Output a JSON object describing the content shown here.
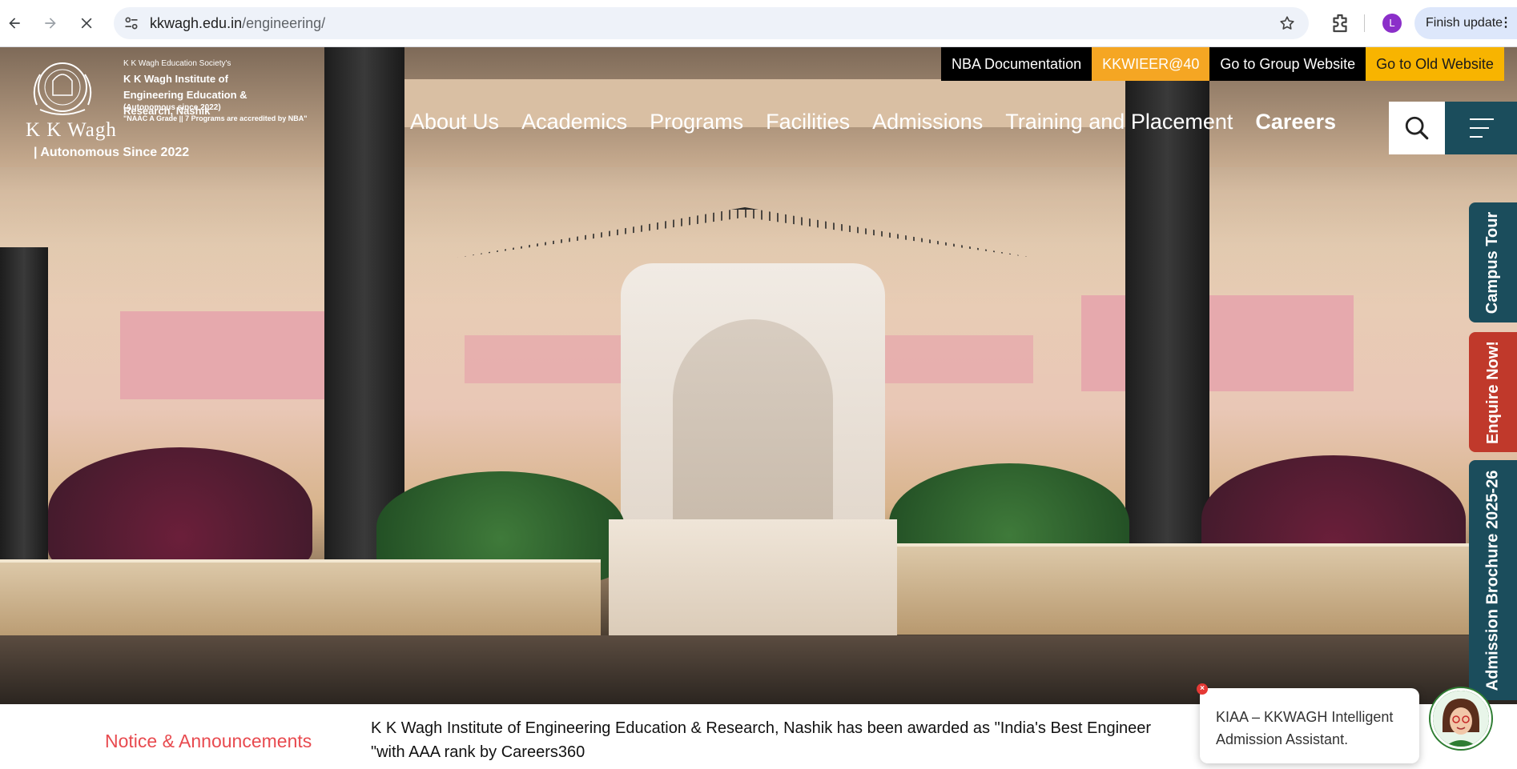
{
  "browser": {
    "url_host": "kkwagh.edu.in",
    "url_path": "/engineering/",
    "finish_update": "Finish update",
    "profile_initial": "L"
  },
  "logo": {
    "society": "K K Wagh Education Society's",
    "institute": "K K Wagh Institute of Engineering Education & Research, Nashik",
    "autonomous": "(Autonomous since 2022)",
    "naac": "\"NAAC A Grade || 7 Programs are accredited by NBA\"",
    "kkwagh": "K K Wagh",
    "since": "| Autonomous Since 2022"
  },
  "top_links": [
    {
      "label": "NBA Documentation"
    },
    {
      "label": "KKWIEER@40"
    },
    {
      "label": "Go to Group Website"
    },
    {
      "label": "Go to Old Website"
    }
  ],
  "main_nav": [
    {
      "label": "About Us"
    },
    {
      "label": "Academics"
    },
    {
      "label": "Programs"
    },
    {
      "label": "Facilities"
    },
    {
      "label": "Admissions"
    },
    {
      "label": "Training and Placement"
    },
    {
      "label": "Careers"
    }
  ],
  "side_tabs": {
    "campus_tour": "Campus Tour",
    "enquire": "Enquire Now!",
    "brochure": "Admission Brochure 2025-26"
  },
  "notice": {
    "title": "Notice & Announcements",
    "line1": "K K Wagh Institute of Engineering Education & Research, Nashik has been awarded as \"India's Best Engineer",
    "line2": "\"with AAA rank by Careers360"
  },
  "chat": {
    "text": "KIAA – KKWAGH Intelligent Admission Assistant.",
    "close": "×"
  },
  "colors": {
    "teal": "#1b4d5c",
    "red": "#c0392b",
    "orange": "#f5a623",
    "notice_red": "#e84a4f"
  }
}
